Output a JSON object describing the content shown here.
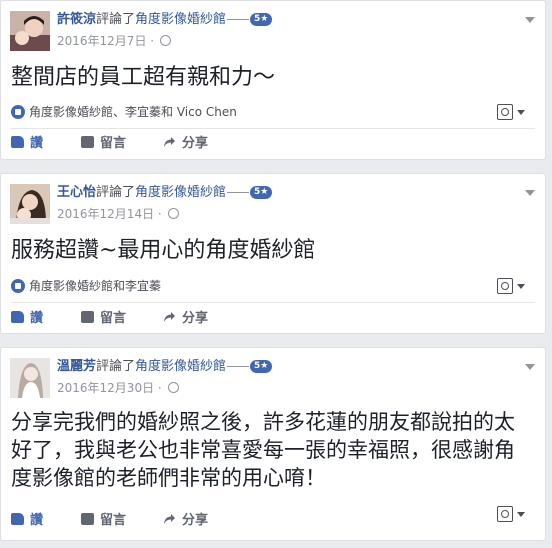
{
  "page_name": "角度影像婚紗館",
  "rating": "5★",
  "verb": "評論了",
  "actions": {
    "like": "讚",
    "comment": "留言",
    "share": "分享"
  },
  "reviews": [
    {
      "author": "許筱涼",
      "date": "2016年12月7日",
      "text": "整間店的員工超有親和力～",
      "likes": "角度影像婚紗館、李宜蓁和 Vico Chen"
    },
    {
      "author": "王心怡",
      "date": "2016年12月14日",
      "text": "服務超讚~最用心的角度婚紗館",
      "likes": "角度影像婚紗館和李宜蓁"
    },
    {
      "author": "溫麗芳",
      "date": "2016年12月30日",
      "text": "分享完我們的婚紗照之後，許多花蓮的朋友都說拍的太好了，我與老公也非常喜愛每一張的幸福照，很感謝角度影像館的老師們非常的用心唷！",
      "likes": ""
    }
  ],
  "colors": {
    "link": "#365899",
    "accent": "#4267b2",
    "meta": "#90949c",
    "background": "#e9ebee"
  },
  "icons": [
    "globe-icon",
    "chevron-down-icon",
    "like-reaction-icon",
    "thumbs-up-icon",
    "comment-icon",
    "share-icon",
    "page-switcher-icon"
  ]
}
